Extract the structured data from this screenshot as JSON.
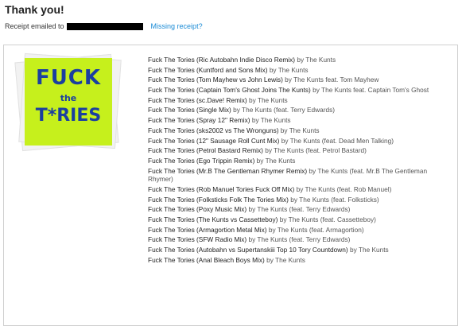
{
  "header": {
    "title": "Thank you!",
    "receipt_label": "Receipt emailed to",
    "missing_receipt_link": "Missing receipt?"
  },
  "album": {
    "cover_line1": "FUCK",
    "cover_line2": "the",
    "cover_line3": "T*RIES"
  },
  "tracks": [
    {
      "title": "Fuck The Tories (Ric Autobahn Indie Disco Remix)",
      "by": "by The Kunts"
    },
    {
      "title": "Fuck The Tories (Kuntford and Sons Mix)",
      "by": "by The Kunts"
    },
    {
      "title": "Fuck The Tories (Tom Mayhew vs John Lewis)",
      "by": "by The Kunts feat. Tom Mayhew"
    },
    {
      "title": "Fuck The Tories (Captain Tom's Ghost Joins The Kunts)",
      "by": "by The Kunts feat. Captain Tom's Ghost"
    },
    {
      "title": "Fuck The Tories (sc.Dave! Remix)",
      "by": "by The Kunts"
    },
    {
      "title": "Fuck The Tories (Single Mix)",
      "by": "by The Kunts (feat. Terry Edwards)"
    },
    {
      "title": "Fuck The Tories (Spray 12\" Remix)",
      "by": "by The Kunts"
    },
    {
      "title": "Fuck The Tories (sks2002 vs The Wronguns)",
      "by": "by The Kunts"
    },
    {
      "title": "Fuck The Tories (12\" Sausage Roll Cunt Mix)",
      "by": "by The Kunts (feat. Dead Men Talking)"
    },
    {
      "title": "Fuck The Tories (Petrol Bastard Remix)",
      "by": "by The Kunts (feat. Petrol Bastard)"
    },
    {
      "title": "Fuck The Tories (Ego Trippin Remix)",
      "by": "by The Kunts"
    },
    {
      "title": "Fuck The Tories (Mr.B The Gentleman Rhymer Remix)",
      "by": "by The Kunts (feat. Mr.B The Gentleman Rhymer)"
    },
    {
      "title": "Fuck The Tories (Rob Manuel Tories Fuck Off Mix)",
      "by": "by The Kunts (feat. Rob Manuel)"
    },
    {
      "title": "Fuck The Tories (Folksticks Folk The Tories Mix)",
      "by": "by The Kunts (feat. Folksticks)"
    },
    {
      "title": "Fuck The Tories (Poxy Music Mix)",
      "by": "by The Kunts (feat. Terry Edwards)"
    },
    {
      "title": "Fuck The Tories (The Kunts vs Cassetteboy)",
      "by": "by The Kunts (feat. Cassetteboy)"
    },
    {
      "title": "Fuck The Tories (Armagortion Metal Mix)",
      "by": "by The Kunts (feat. Armagortion)"
    },
    {
      "title": "Fuck The Tories (SFW Radio Mix)",
      "by": "by The Kunts (feat. Terry Edwards)"
    },
    {
      "title": "Fuck The Tories (Autobahn vs Supertanskiii Top 10 Tory Countdown)",
      "by": "by The Kunts"
    },
    {
      "title": "Fuck The Tories (Anal Bleach Boys Mix)",
      "by": "by The Kunts"
    }
  ]
}
